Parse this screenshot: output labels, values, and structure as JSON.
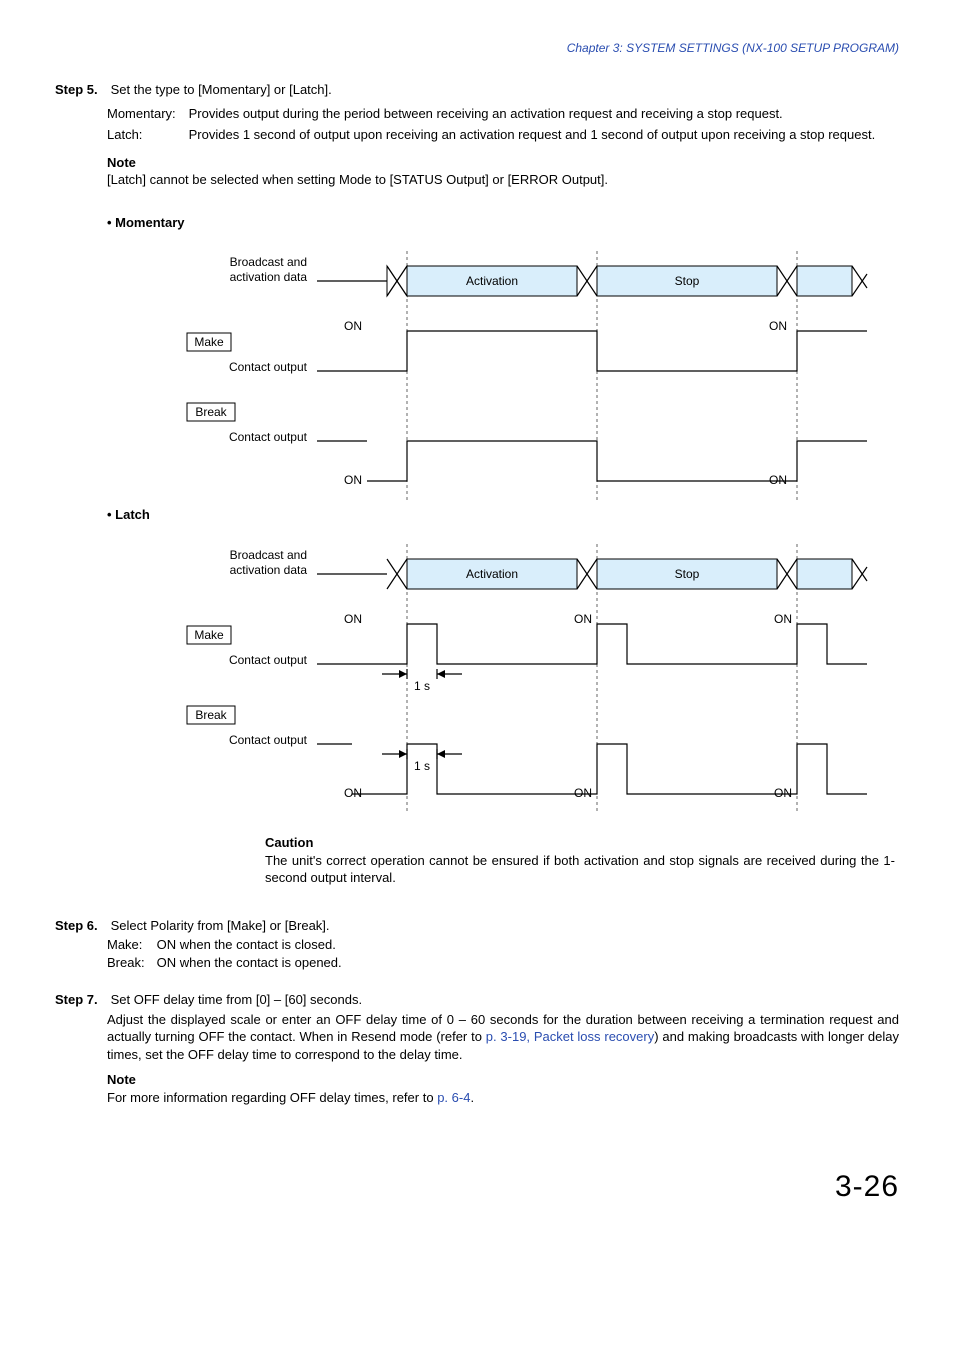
{
  "header": {
    "chapter": "Chapter 3:  SYSTEM SETTINGS (NX-100 SETUP PROGRAM)"
  },
  "step5": {
    "label": "Step 5.",
    "intro": "Set the type to [Momentary] or [Latch].",
    "momentary_term": "Momentary:",
    "momentary_desc": "Provides output during the period between receiving an activation request and receiving a stop request.",
    "latch_term": "Latch:",
    "latch_desc": "Provides 1 second of output upon receiving an activation request and 1 second of output upon receiving a stop request.",
    "note_label": "Note",
    "note_text": "[Latch] cannot be selected when setting Mode to [STATUS Output] or [ERROR Output]."
  },
  "diagram": {
    "momentary_title": "• Momentary",
    "latch_title": "• Latch",
    "broadcast_l1": "Broadcast and",
    "broadcast_l2": "activation data",
    "activation": "Activation",
    "stop": "Stop",
    "on": "ON",
    "make": "Make",
    "break": "Break",
    "contact_output": "Contact output",
    "one_s": "1 s"
  },
  "caution": {
    "label": "Caution",
    "text": "The unit's correct operation cannot be ensured if both activation and stop signals are received during the 1-second output interval."
  },
  "step6": {
    "label": "Step 6.",
    "intro": "Select Polarity from [Make] or [Break].",
    "make_term": "Make:",
    "make_desc": "ON when the contact is closed.",
    "break_term": "Break:",
    "break_desc": "ON when the contact is opened."
  },
  "step7": {
    "label": "Step 7.",
    "intro": "Set OFF delay time from [0] – [60] seconds.",
    "body_a": "Adjust the displayed scale or enter an OFF delay time of 0 – 60 seconds for the duration between receiving a termination request and actually turning OFF the contact. When in Resend mode (refer to ",
    "link1": "p. 3-19, Packet loss recovery",
    "body_b": ") and making broadcasts with longer delay times, set the OFF delay time to correspond to the delay time.",
    "note_label": "Note",
    "note_a": "For more information regarding OFF delay times, refer to ",
    "link2": "p. 6-4",
    "note_b": "."
  },
  "page": "3-26"
}
